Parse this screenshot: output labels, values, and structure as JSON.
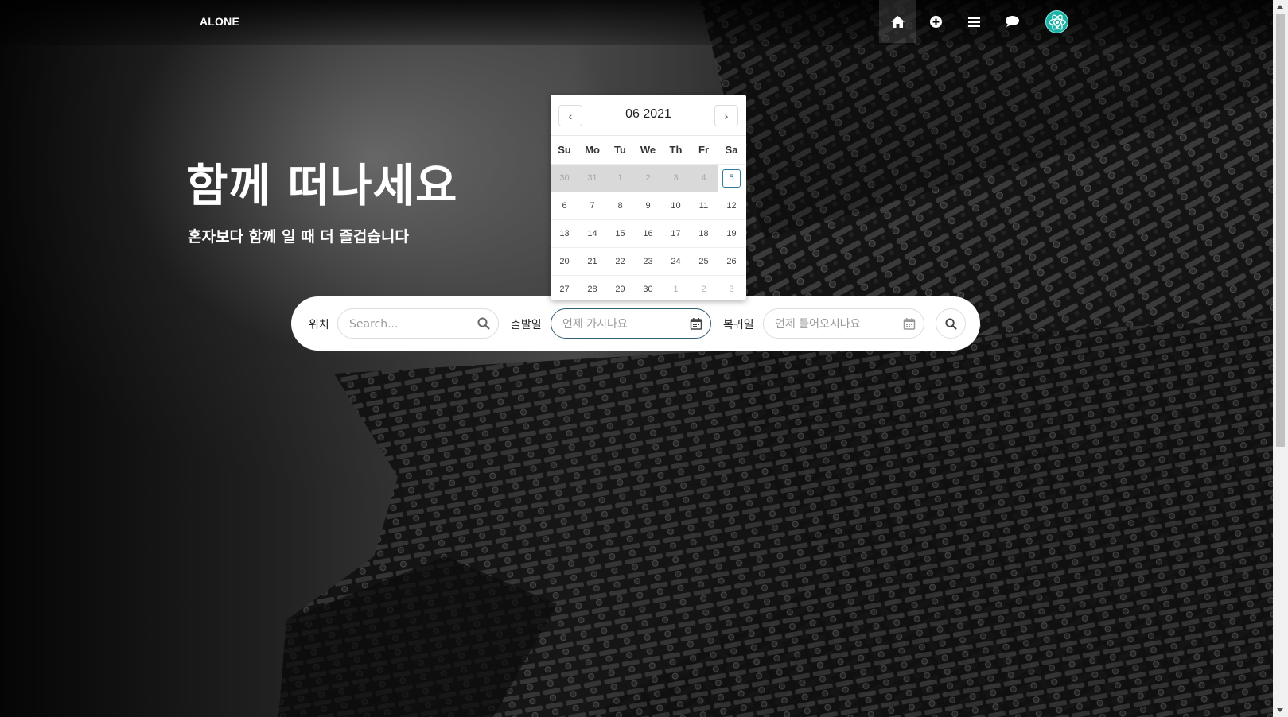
{
  "nav": {
    "brand": "ALONE",
    "icons": [
      "home-icon",
      "plus-circle-icon",
      "list-icon",
      "chat-icon",
      "react-logo-icon"
    ]
  },
  "hero": {
    "title": "함께 떠나세요",
    "subtitle": "혼자보다 함께 일 때 더 즐겁습니다"
  },
  "search": {
    "location_label": "위치",
    "location_placeholder": "Search...",
    "depart_label": "출발일",
    "depart_placeholder": "언제 가시나요",
    "return_label": "복귀일",
    "return_placeholder": "언제 들어오시나요"
  },
  "calendar": {
    "prev": "‹",
    "next": "›",
    "month_year": "06 2021",
    "weekdays": [
      "Su",
      "Mo",
      "Tu",
      "We",
      "Th",
      "Fr",
      "Sa"
    ],
    "weeks": [
      [
        "30",
        "31",
        "1",
        "2",
        "3",
        "4",
        "5"
      ],
      [
        "6",
        "7",
        "8",
        "9",
        "10",
        "11",
        "12"
      ],
      [
        "13",
        "14",
        "15",
        "16",
        "17",
        "18",
        "19"
      ],
      [
        "20",
        "21",
        "22",
        "23",
        "24",
        "25",
        "26"
      ],
      [
        "27",
        "28",
        "29",
        "30",
        "1",
        "2",
        "3"
      ]
    ],
    "today": "5"
  },
  "colors": {
    "accent": "#2f7ea0",
    "avatar": "#1bb3a5"
  }
}
